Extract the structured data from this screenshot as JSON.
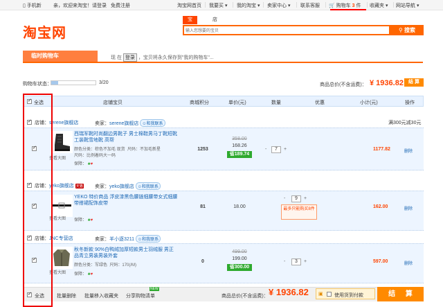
{
  "topbar": {
    "mobile": "手机新",
    "welcome": "亲，欢迎来淘宝！请登录",
    "register": "免费注册",
    "home": "淘宝网首页",
    "buy": "我要买",
    "my_taobao": "我的淘宝",
    "seller_center": "卖家中心",
    "service": "联系客服",
    "cart_label": "购物车",
    "cart_count": "3",
    "cart_unit": "件",
    "favorites": "收藏夹",
    "site_nav": "网站导航"
  },
  "header": {
    "logo": "淘宝网",
    "tabs": [
      "宝贝",
      "店铺"
    ],
    "search_placeholder": "输入您想要的宝贝",
    "search_button": "搜索"
  },
  "banner": {
    "title": "临时购物车",
    "tip_before": "现 在",
    "tip_login": "登录",
    "tip_after": "，宝贝将永久保存到\"我的购物车\"..."
  },
  "status": {
    "label": "购物车状态：",
    "progress": 0.15,
    "count": "3/20",
    "total_label": "商品总价(不含运费)：",
    "total": "¥ 1936.82",
    "checkout": "结 算"
  },
  "columns": {
    "select_all": "全选",
    "item": "店铺宝贝",
    "points": "商城积分",
    "unit_price": "单价(元)",
    "quantity": "数量",
    "discount": "优惠",
    "subtotal": "小计(元)",
    "action": "操作"
  },
  "shops": [
    {
      "shop_label": "店铺：",
      "shop_name": "serene旗舰店",
      "seller_label": "卖家：",
      "seller_name": "serene旗舰店",
      "contact": "和我联系",
      "promo": "满300元减30元",
      "items": [
        {
          "title": "西瑞军靴时尚翻边男靴子 男士棉鞋男马丁靴短靴工装靴雪地靴 高帮",
          "color": "颜色分类：棕色不加毛 现货",
          "size": "尺码：不加毛新星",
          "size2": "尺码：比例着码大一码",
          "guarantee": "保障：",
          "view": "查看大图",
          "points": "1253",
          "old_price": "358.00",
          "price": "168.26",
          "promo_price": "省189.74",
          "qty": "7",
          "subtotal": "1177.82",
          "delete": "删除"
        }
      ]
    },
    {
      "shop_label": "店铺：",
      "shop_name": "yeko旗舰店",
      "badge": "天猫",
      "seller_label": "卖家：",
      "seller_name": "yeko旗舰店",
      "contact": "和我联系",
      "items": [
        {
          "title": "YEKO 特价商品 浮皮漆黑色腰链细腰带女式细腰带搭裙配饰皮带",
          "guarantee": "保障：",
          "view": "查看大图",
          "points": "81",
          "price": "18.00",
          "qty": "9",
          "qty_warn": "最多只能购买8件",
          "subtotal": "162.00",
          "delete": "删除"
        }
      ]
    },
    {
      "shop_label": "店铺：",
      "shop_name": "JNC专营店",
      "seller_label": "卖家：",
      "seller_name": "羊小逐3211",
      "contact": "和我联系",
      "items": [
        {
          "title": "秋冬新款 90%白鸭绒加厚短款男士羽绒服 男正品青立男装男装外套",
          "color": "颜色分类：军绿色",
          "size": "尺码：170(/M)",
          "guarantee": "保障：",
          "view": "查看大图",
          "points": "0",
          "old_price": "499.00",
          "price": "199.00",
          "promo_price": "省300.00",
          "qty": "3",
          "subtotal": "597.00",
          "delete": "删除"
        }
      ]
    }
  ],
  "footer": {
    "select_all": "全选",
    "batch_delete": "批量删除",
    "batch_favorite": "批量移入收藏夹",
    "share": "分享购物清单",
    "new_badge": "NEW",
    "total_label": "商品总价(不含运费)：",
    "total": "¥ 1936.82",
    "coupon": "使用货到付款",
    "checkout": "结 算"
  }
}
